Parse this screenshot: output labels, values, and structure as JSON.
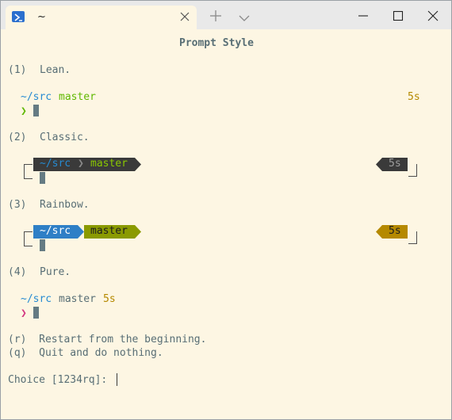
{
  "tab": {
    "title": "~"
  },
  "prompt": {
    "heading": "Prompt Style",
    "options": [
      {
        "key": "(1)",
        "name": "Lean."
      },
      {
        "key": "(2)",
        "name": "Classic."
      },
      {
        "key": "(3)",
        "name": "Rainbow."
      },
      {
        "key": "(4)",
        "name": "Pure."
      }
    ],
    "lean": {
      "dir": "~/src",
      "branch": "master",
      "time": "5s",
      "symbol": "❯"
    },
    "classic": {
      "dir": "~/src",
      "sep": "❯",
      "branch": "master",
      "time": "5s"
    },
    "rainbow": {
      "dir": "~/src",
      "branch": "master",
      "time": "5s"
    },
    "pure": {
      "dir": "~/src",
      "branch": "master",
      "time": "5s",
      "symbol": "❯"
    },
    "restart": "(r)  Restart from the beginning.",
    "quit": "(q)  Quit and do nothing.",
    "choice": "Choice [1234rq]: "
  },
  "colors": {
    "background": "#fdf6e3",
    "dir_blue": "#268bd2",
    "branch_green": "#5fb800",
    "classic_bg": "#3a3a3a",
    "rainbow_dir_bg": "#2e7fc6",
    "rainbow_branch_bg": "#8a9a00",
    "rainbow_time_bg": "#b58900"
  }
}
